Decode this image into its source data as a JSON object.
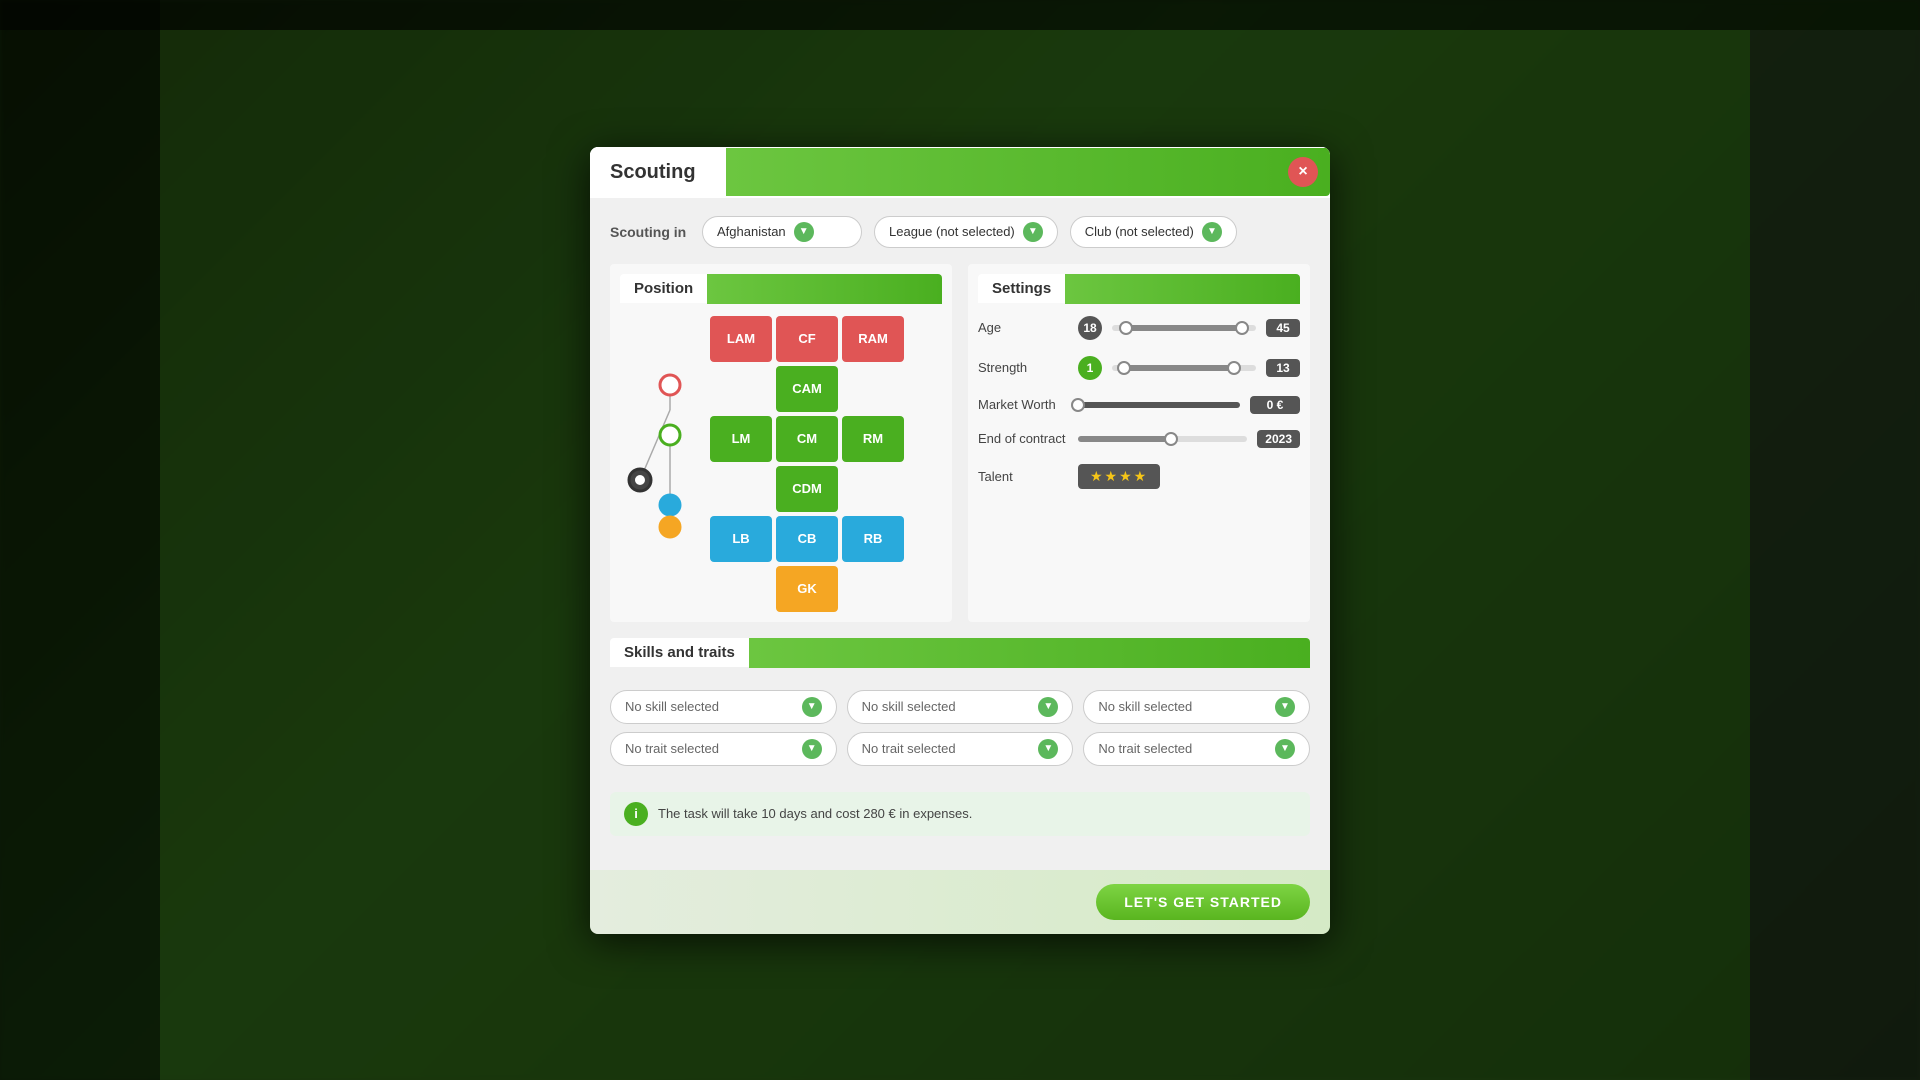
{
  "modal": {
    "title": "Scouting",
    "close_label": "×"
  },
  "scouting_in": {
    "label": "Scouting in",
    "country": "Afghanistan",
    "league": "League (not selected)",
    "club": "Club (not selected)"
  },
  "position": {
    "title": "Position",
    "positions": [
      {
        "id": "LAM",
        "label": "LAM",
        "color": "red",
        "col": 1,
        "row": 1
      },
      {
        "id": "CF",
        "label": "CF",
        "color": "red",
        "col": 2,
        "row": 1
      },
      {
        "id": "RAM",
        "label": "RAM",
        "color": "red",
        "col": 3,
        "row": 1
      },
      {
        "id": "CAM",
        "label": "CAM",
        "color": "green",
        "col": 2,
        "row": 2
      },
      {
        "id": "LM",
        "label": "LM",
        "color": "green",
        "col": 1,
        "row": 3
      },
      {
        "id": "CM",
        "label": "CM",
        "color": "green",
        "col": 2,
        "row": 3
      },
      {
        "id": "RM",
        "label": "RM",
        "color": "green",
        "col": 3,
        "row": 3
      },
      {
        "id": "CDM",
        "label": "CDM",
        "color": "green",
        "col": 2,
        "row": 4
      },
      {
        "id": "LB",
        "label": "LB",
        "color": "blue",
        "col": 1,
        "row": 5
      },
      {
        "id": "CB",
        "label": "CB",
        "color": "blue",
        "col": 2,
        "row": 5
      },
      {
        "id": "RB",
        "label": "RB",
        "color": "blue",
        "col": 3,
        "row": 5
      },
      {
        "id": "GK",
        "label": "GK",
        "color": "orange",
        "col": 2,
        "row": 6
      }
    ]
  },
  "settings": {
    "title": "Settings",
    "age": {
      "label": "Age",
      "min": 18,
      "max": 45,
      "min_pct": 10,
      "max_pct": 90
    },
    "strength": {
      "label": "Strength",
      "min": 1,
      "max": 13,
      "min_pct": 8,
      "max_pct": 85
    },
    "market_worth": {
      "label": "Market Worth",
      "value": "0 €",
      "handle_pct": 0
    },
    "end_of_contract": {
      "label": "End of contract",
      "value": "2023",
      "handle_pct": 55
    },
    "talent": {
      "label": "Talent",
      "stars": "★★★★"
    }
  },
  "skills_and_traits": {
    "title": "Skills and traits",
    "columns": [
      {
        "skill": "No skill selected",
        "trait": "No trait selected"
      },
      {
        "skill": "No skill selected",
        "trait": "No trait selected"
      },
      {
        "skill": "No skill selected",
        "trait": "No trait selected"
      }
    ]
  },
  "info": {
    "text": "The task will take 10 days and cost 280 € in expenses."
  },
  "footer": {
    "start_button": "LET'S GET STARTED"
  }
}
